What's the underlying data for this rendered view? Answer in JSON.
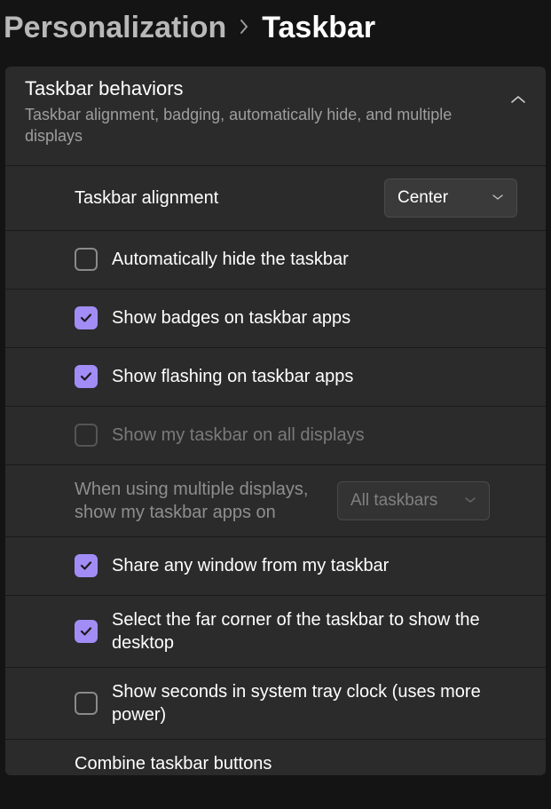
{
  "breadcrumb": {
    "parent": "Personalization",
    "current": "Taskbar"
  },
  "section": {
    "title": "Taskbar behaviors",
    "subtitle": "Taskbar alignment, badging, automatically hide, and multiple displays"
  },
  "rows": {
    "alignment": {
      "label": "Taskbar alignment",
      "value": "Center"
    },
    "autohide": {
      "label": "Automatically hide the taskbar"
    },
    "badges": {
      "label": "Show badges on taskbar apps"
    },
    "flashing": {
      "label": "Show flashing on taskbar apps"
    },
    "alldisplays": {
      "label": "Show my taskbar on all displays"
    },
    "multidisplay": {
      "label": "When using multiple displays, show my taskbar apps on",
      "value": "All taskbars"
    },
    "sharewindow": {
      "label": "Share any window from my taskbar"
    },
    "farcorner": {
      "label": "Select the far corner of the taskbar to show the desktop"
    },
    "clockseconds": {
      "label": "Show seconds in system tray clock (uses more power)"
    },
    "combine": {
      "label": "Combine taskbar buttons"
    }
  }
}
